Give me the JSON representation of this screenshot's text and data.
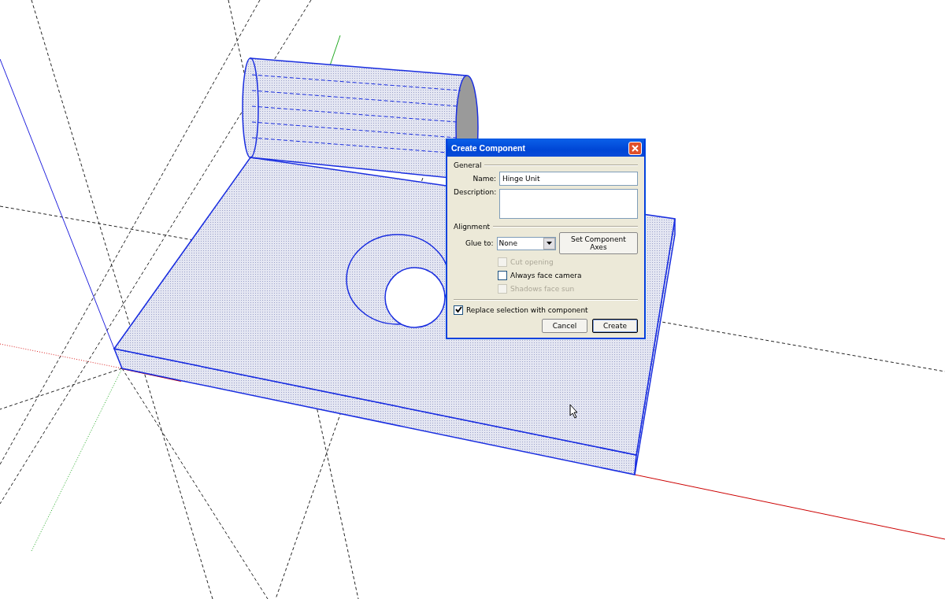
{
  "dialog": {
    "title": "Create Component",
    "general": {
      "heading": "General",
      "name_label": "Name:",
      "name_value": "Hinge Unit",
      "description_label": "Description:"
    },
    "alignment": {
      "heading": "Alignment",
      "glue_label": "Glue to:",
      "glue_value": "None",
      "axes_button": "Set Component Axes",
      "options": [
        {
          "label": "Cut opening",
          "checked": false,
          "disabled": true
        },
        {
          "label": "Always face camera",
          "checked": false,
          "disabled": false
        },
        {
          "label": "Shadows face sun",
          "checked": false,
          "disabled": true
        }
      ]
    },
    "replace": {
      "label": "Replace selection with component",
      "checked": true,
      "disabled": false
    },
    "buttons": [
      {
        "label": "Cancel",
        "default": false
      },
      {
        "label": "Create",
        "default": true
      }
    ]
  }
}
